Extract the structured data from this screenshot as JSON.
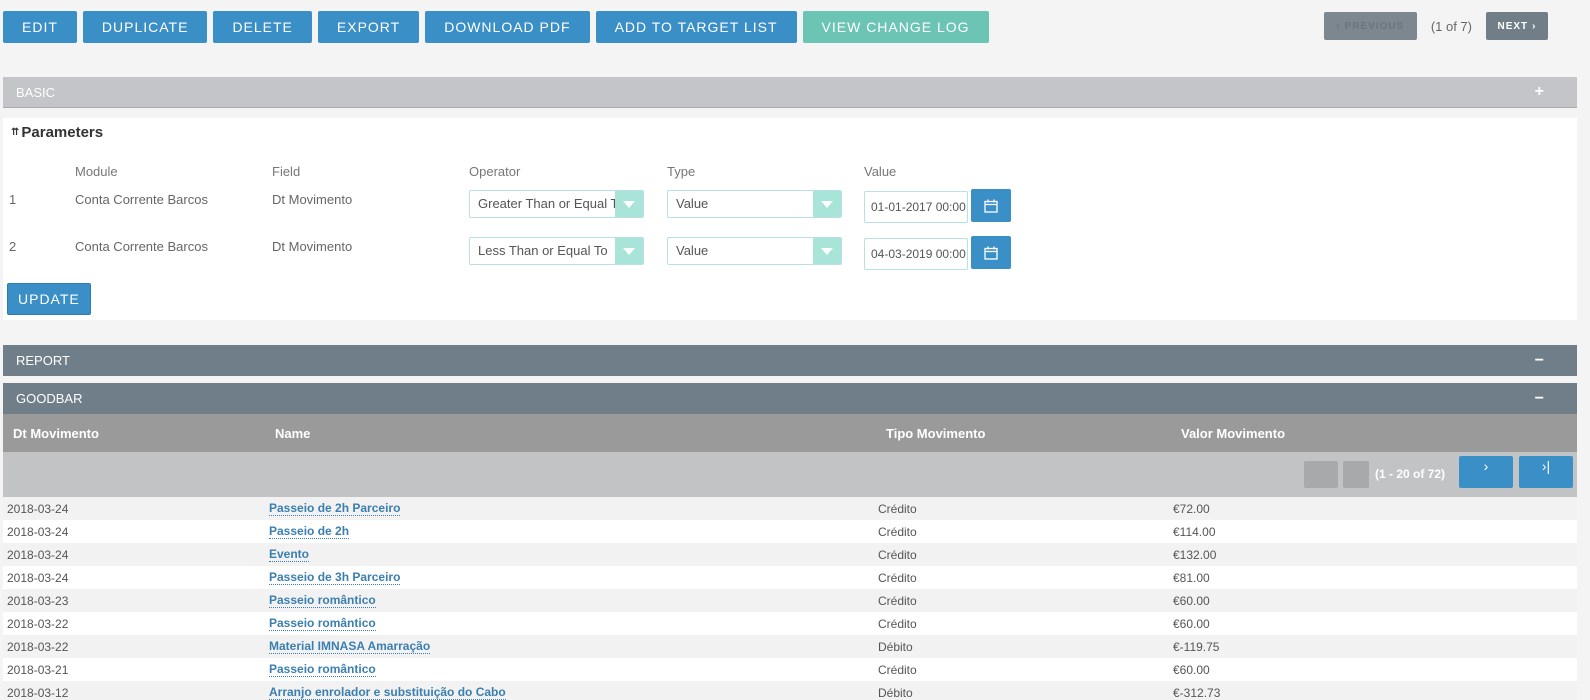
{
  "toolbar": {
    "buttons": [
      "EDIT",
      "DUPLICATE",
      "DELETE",
      "EXPORT",
      "DOWNLOAD PDF",
      "ADD TO TARGET LIST",
      "VIEW CHANGE LOG"
    ],
    "prev_label": "PREVIOUS",
    "page_info": "(1 of 7)",
    "next_label": "NEXT"
  },
  "panels": {
    "basic": {
      "title": "BASIC",
      "toggle": "+"
    },
    "report": {
      "title": "REPORT",
      "toggle": "−"
    },
    "goodbar": {
      "title": "GOODBAR",
      "toggle": "−"
    }
  },
  "parameters": {
    "title": "Parameters",
    "headers": {
      "module": "Module",
      "field": "Field",
      "operator": "Operator",
      "type": "Type",
      "value": "Value"
    },
    "rows": [
      {
        "num": "1",
        "module": "Conta Corrente Barcos",
        "field": "Dt Movimento",
        "operator": "Greater Than or Equal To",
        "type": "Value",
        "value": "01-01-2017 00:00"
      },
      {
        "num": "2",
        "module": "Conta Corrente Barcos",
        "field": "Dt Movimento",
        "operator": "Less Than or Equal To",
        "type": "Value",
        "value": "04-03-2019 00:00"
      }
    ],
    "update_label": "UPDATE"
  },
  "table": {
    "headers": {
      "date": "Dt Movimento",
      "name": "Name",
      "tipo": "Tipo Movimento",
      "valor": "Valor Movimento"
    },
    "pagination": "(1 - 20 of 72)",
    "rows": [
      {
        "date": "2018-03-24",
        "name": "Passeio de 2h Parceiro",
        "tipo": "Crédito",
        "valor": "€72.00"
      },
      {
        "date": "2018-03-24",
        "name": "Passeio de 2h",
        "tipo": "Crédito",
        "valor": "€114.00"
      },
      {
        "date": "2018-03-24",
        "name": "Evento",
        "tipo": "Crédito",
        "valor": "€132.00"
      },
      {
        "date": "2018-03-24",
        "name": "Passeio de 3h Parceiro",
        "tipo": "Crédito",
        "valor": "€81.00"
      },
      {
        "date": "2018-03-23",
        "name": "Passeio romântico",
        "tipo": "Crédito",
        "valor": "€60.00"
      },
      {
        "date": "2018-03-22",
        "name": "Passeio romântico",
        "tipo": "Crédito",
        "valor": "€60.00"
      },
      {
        "date": "2018-03-22",
        "name": "Material IMNASA Amarração",
        "tipo": "Débito",
        "valor": "€-119.75"
      },
      {
        "date": "2018-03-21",
        "name": "Passeio romântico",
        "tipo": "Crédito",
        "valor": "€60.00"
      },
      {
        "date": "2018-03-12",
        "name": "Arranjo enrolador e substituição do Cabo",
        "tipo": "Débito",
        "valor": "€-312.73"
      }
    ]
  }
}
